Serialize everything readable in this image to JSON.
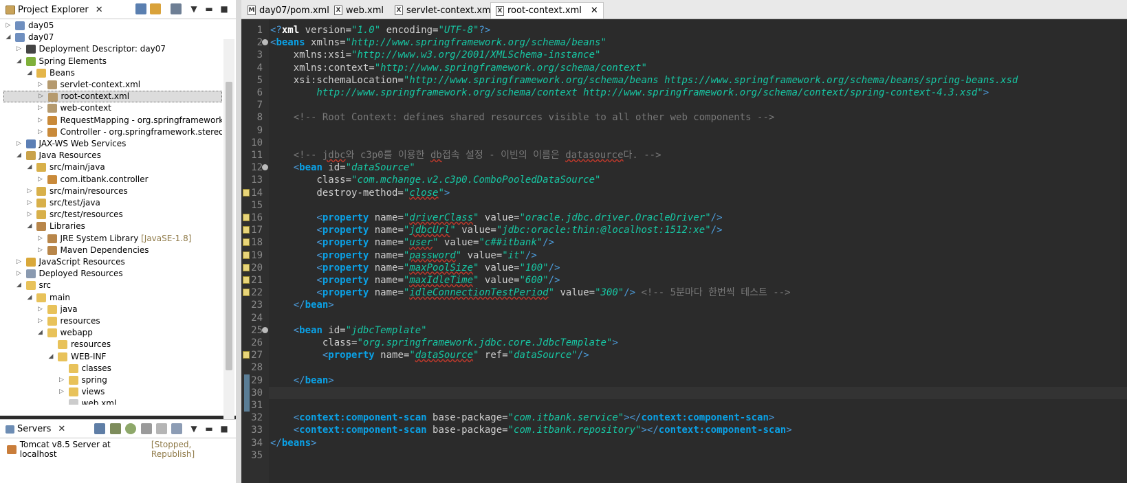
{
  "explorer": {
    "title": "Project Explorer",
    "tree": [
      {
        "label": "day05",
        "level": 0,
        "expanded": false,
        "icon": "project-icon"
      },
      {
        "label": "day07",
        "level": 0,
        "expanded": true,
        "icon": "project-icon"
      },
      {
        "label": "Deployment Descriptor: day07",
        "level": 1,
        "expanded": false,
        "icon": "descriptor-icon"
      },
      {
        "label": "Spring Elements",
        "level": 1,
        "expanded": true,
        "icon": "spring-leaf-icon"
      },
      {
        "label": "Beans",
        "level": 2,
        "expanded": true,
        "icon": "beans-folder-icon"
      },
      {
        "label": "servlet-context.xml",
        "level": 3,
        "expanded": false,
        "icon": "bean-file-icon"
      },
      {
        "label": "root-context.xml",
        "level": 3,
        "expanded": false,
        "icon": "bean-file-icon",
        "selected": true
      },
      {
        "label": "web-context",
        "level": 3,
        "expanded": false,
        "icon": "bean-file-icon"
      },
      {
        "label": "RequestMapping - org.springframework.web.b",
        "level": 3,
        "expanded": false,
        "icon": "annotation-icon"
      },
      {
        "label": "Controller - org.springframework.stereotype",
        "level": 3,
        "expanded": false,
        "icon": "annotation-icon"
      },
      {
        "label": "JAX-WS Web Services",
        "level": 1,
        "expanded": false,
        "icon": "webservice-icon"
      },
      {
        "label": "Java Resources",
        "level": 1,
        "expanded": true,
        "icon": "java-resources-icon"
      },
      {
        "label": "src/main/java",
        "level": 2,
        "expanded": true,
        "icon": "source-folder-icon"
      },
      {
        "label": "com.itbank.controller",
        "level": 3,
        "expanded": false,
        "icon": "package-icon"
      },
      {
        "label": "src/main/resources",
        "level": 2,
        "expanded": false,
        "icon": "source-folder-icon"
      },
      {
        "label": "src/test/java",
        "level": 2,
        "expanded": false,
        "icon": "source-folder-icon"
      },
      {
        "label": "src/test/resources",
        "level": 2,
        "expanded": false,
        "icon": "source-folder-icon"
      },
      {
        "label": "Libraries",
        "level": 2,
        "expanded": true,
        "icon": "library-icon"
      },
      {
        "label": "JRE System Library",
        "extra": "[JavaSE-1.8]",
        "level": 3,
        "expanded": false,
        "icon": "library-icon"
      },
      {
        "label": "Maven Dependencies",
        "level": 3,
        "expanded": false,
        "icon": "library-icon"
      },
      {
        "label": "JavaScript Resources",
        "level": 1,
        "expanded": false,
        "icon": "js-resources-icon"
      },
      {
        "label": "Deployed Resources",
        "level": 1,
        "expanded": false,
        "icon": "deployed-icon"
      },
      {
        "label": "src",
        "level": 1,
        "expanded": true,
        "icon": "folder-icon"
      },
      {
        "label": "main",
        "level": 2,
        "expanded": true,
        "icon": "folder-icon"
      },
      {
        "label": "java",
        "level": 3,
        "expanded": false,
        "icon": "folder-icon"
      },
      {
        "label": "resources",
        "level": 3,
        "expanded": false,
        "icon": "folder-icon"
      },
      {
        "label": "webapp",
        "level": 3,
        "expanded": true,
        "icon": "folder-icon"
      },
      {
        "label": "resources",
        "level": 4,
        "expanded": null,
        "icon": "folder-icon"
      },
      {
        "label": "WEB-INF",
        "level": 4,
        "expanded": true,
        "icon": "folder-icon"
      },
      {
        "label": "classes",
        "level": 5,
        "expanded": null,
        "icon": "folder-icon"
      },
      {
        "label": "spring",
        "level": 5,
        "expanded": false,
        "icon": "folder-icon"
      },
      {
        "label": "views",
        "level": 5,
        "expanded": false,
        "icon": "folder-icon"
      },
      {
        "label": "web.xml",
        "level": 5,
        "expanded": null,
        "icon": "xml-file-icon"
      }
    ]
  },
  "servers": {
    "title": "Servers",
    "entries": [
      {
        "label": "Tomcat v8.5 Server at localhost",
        "status": "[Stopped, Republish]"
      }
    ]
  },
  "editor": {
    "tabs": [
      {
        "label": "day07/pom.xml",
        "icon": "maven-file-icon",
        "active": false
      },
      {
        "label": "web.xml",
        "icon": "xml-file-icon",
        "active": false
      },
      {
        "label": "servlet-context.xml",
        "icon": "xml-file-icon",
        "active": false
      },
      {
        "label": "root-context.xml",
        "icon": "xml-file-icon",
        "active": true
      }
    ],
    "lines": [
      [
        [
          "pi",
          "<?"
        ],
        [
          "kw",
          "xml"
        ],
        [
          "at",
          " version="
        ],
        [
          "st",
          "\"1.0\""
        ],
        [
          "at",
          " encoding="
        ],
        [
          "st",
          "\"UTF-8\""
        ],
        [
          "pi",
          "?>"
        ]
      ],
      [
        [
          "pi",
          "<"
        ],
        [
          "tg",
          "beans"
        ],
        [
          "at",
          " xmlns="
        ],
        [
          "st",
          "\"http://www.springframework.org/schema/beans\""
        ]
      ],
      [
        [
          "at",
          "    xmlns:xsi="
        ],
        [
          "st",
          "\"http://www.w3.org/2001/XMLSchema-instance\""
        ]
      ],
      [
        [
          "at",
          "    xmlns:context="
        ],
        [
          "st",
          "\"http://www.springframework.org/schema/context\""
        ]
      ],
      [
        [
          "at",
          "    xsi:schemaLocation="
        ],
        [
          "st",
          "\"http://www.springframework.org/schema/beans https://www.springframework.org/schema/beans/spring-beans.xsd"
        ]
      ],
      [
        [
          "st",
          "        http://www.springframework.org/schema/context http://www.springframework.org/schema/context/spring-context-4.3.xsd\""
        ],
        [
          "pi",
          ">"
        ]
      ],
      [],
      [
        [
          "cm",
          "    <!-- Root Context: defines shared resources visible to all other web components -->"
        ]
      ],
      [],
      [],
      [
        [
          "cm",
          "    <!-- "
        ],
        [
          "cm sq",
          "jdbc"
        ],
        [
          "cm",
          "와 c3p0를 이용한 "
        ],
        [
          "cm sq",
          "db"
        ],
        [
          "cm",
          "접속 설정 - 이빈의 이름은 "
        ],
        [
          "cm sq",
          "datasource"
        ],
        [
          "cm",
          "다. -->"
        ]
      ],
      [
        [
          "pi",
          "    <"
        ],
        [
          "tg",
          "bean"
        ],
        [
          "at",
          " id="
        ],
        [
          "st",
          "\"dataSource\""
        ]
      ],
      [
        [
          "at",
          "        class="
        ],
        [
          "st",
          "\"com.mchange.v2.c3p0.ComboPooledDataSource\""
        ]
      ],
      [
        [
          "at",
          "        destroy-method="
        ],
        [
          "st",
          "\""
        ],
        [
          "st sq",
          "close"
        ],
        [
          "st",
          "\""
        ],
        [
          "pi",
          ">"
        ]
      ],
      [],
      [
        [
          "pi",
          "        <"
        ],
        [
          "tg",
          "property"
        ],
        [
          "at",
          " name="
        ],
        [
          "st",
          "\""
        ],
        [
          "st sq",
          "driverClass"
        ],
        [
          "st",
          "\""
        ],
        [
          "at",
          " value="
        ],
        [
          "st",
          "\"oracle.jdbc.driver.OracleDriver\""
        ],
        [
          "pi",
          "/>"
        ]
      ],
      [
        [
          "pi",
          "        <"
        ],
        [
          "tg",
          "property"
        ],
        [
          "at",
          " name="
        ],
        [
          "st",
          "\""
        ],
        [
          "st sq",
          "jdbcUrl"
        ],
        [
          "st",
          "\""
        ],
        [
          "at",
          " value="
        ],
        [
          "st",
          "\"jdbc:oracle:thin:@localhost:1512:xe\""
        ],
        [
          "pi",
          "/>"
        ]
      ],
      [
        [
          "pi",
          "        <"
        ],
        [
          "tg",
          "property"
        ],
        [
          "at",
          " name="
        ],
        [
          "st",
          "\""
        ],
        [
          "st sq",
          "user"
        ],
        [
          "st",
          "\""
        ],
        [
          "at",
          " value="
        ],
        [
          "st",
          "\"c##itbank\""
        ],
        [
          "pi",
          "/>"
        ]
      ],
      [
        [
          "pi",
          "        <"
        ],
        [
          "tg",
          "property"
        ],
        [
          "at",
          " name="
        ],
        [
          "st",
          "\""
        ],
        [
          "st sq",
          "password"
        ],
        [
          "st",
          "\""
        ],
        [
          "at",
          " value="
        ],
        [
          "st",
          "\"it\""
        ],
        [
          "pi",
          "/>"
        ]
      ],
      [
        [
          "pi",
          "        <"
        ],
        [
          "tg",
          "property"
        ],
        [
          "at",
          " name="
        ],
        [
          "st",
          "\""
        ],
        [
          "st sq",
          "maxPoolSize"
        ],
        [
          "st",
          "\""
        ],
        [
          "at",
          " value="
        ],
        [
          "st",
          "\"100\""
        ],
        [
          "pi",
          "/>"
        ]
      ],
      [
        [
          "pi",
          "        <"
        ],
        [
          "tg",
          "property"
        ],
        [
          "at",
          " name="
        ],
        [
          "st",
          "\""
        ],
        [
          "st sq",
          "maxIdleTime"
        ],
        [
          "st",
          "\""
        ],
        [
          "at",
          " value="
        ],
        [
          "st",
          "\"600\""
        ],
        [
          "pi",
          "/>"
        ]
      ],
      [
        [
          "pi",
          "        <"
        ],
        [
          "tg",
          "property"
        ],
        [
          "at",
          " name="
        ],
        [
          "st",
          "\""
        ],
        [
          "st sq",
          "idleConnectionTestPeriod"
        ],
        [
          "st",
          "\""
        ],
        [
          "at",
          " value="
        ],
        [
          "st",
          "\"300\""
        ],
        [
          "pi",
          "/>"
        ],
        [
          "cm",
          " <!-- 5분마다 한번씩 테스트 -->"
        ]
      ],
      [
        [
          "pi",
          "    </"
        ],
        [
          "tg",
          "bean"
        ],
        [
          "pi",
          ">"
        ]
      ],
      [],
      [
        [
          "pi",
          "    <"
        ],
        [
          "tg",
          "bean"
        ],
        [
          "at",
          " id="
        ],
        [
          "st",
          "\"jdbcTemplate\""
        ]
      ],
      [
        [
          "at",
          "         class="
        ],
        [
          "st",
          "\"org.springframework.jdbc.core.JdbcTemplate\""
        ],
        [
          "pi",
          ">"
        ]
      ],
      [
        [
          "pi",
          "         <"
        ],
        [
          "tg",
          "property"
        ],
        [
          "at",
          " name="
        ],
        [
          "st",
          "\""
        ],
        [
          "st sq",
          "dataSource"
        ],
        [
          "st",
          "\""
        ],
        [
          "at",
          " ref="
        ],
        [
          "st",
          "\"dataSource\""
        ],
        [
          "pi",
          "/>"
        ]
      ],
      [],
      [
        [
          "pi",
          "    </"
        ],
        [
          "tg",
          "bean"
        ],
        [
          "pi",
          ">"
        ]
      ],
      [],
      [],
      [
        [
          "pi",
          "    <"
        ],
        [
          "tg",
          "context:component-scan"
        ],
        [
          "at",
          " base-package="
        ],
        [
          "st",
          "\"com.itbank.service\""
        ],
        [
          "pi",
          "></"
        ],
        [
          "tg",
          "context:component-scan"
        ],
        [
          "pi",
          ">"
        ]
      ],
      [
        [
          "pi",
          "    <"
        ],
        [
          "tg",
          "context:component-scan"
        ],
        [
          "at",
          " base-package="
        ],
        [
          "st",
          "\"com.itbank.repository\""
        ],
        [
          "pi",
          "></"
        ],
        [
          "tg",
          "context:component-scan"
        ],
        [
          "pi",
          ">"
        ]
      ],
      [
        [
          "pi",
          "</"
        ],
        [
          "tg",
          "beans"
        ],
        [
          "pi",
          ">"
        ]
      ],
      []
    ],
    "fold_lines": [
      2,
      12,
      25
    ],
    "marker_lines": [
      14,
      16,
      17,
      18,
      19,
      20,
      21,
      22,
      27
    ],
    "changed_lines": [
      29,
      30,
      31
    ],
    "current_line": 30
  },
  "colors": {
    "editor_bg": "#2b2b2b",
    "tag": "#0aa1e6",
    "string": "#17c6a3",
    "comment": "#787878",
    "selection": "#dcdcdc"
  }
}
